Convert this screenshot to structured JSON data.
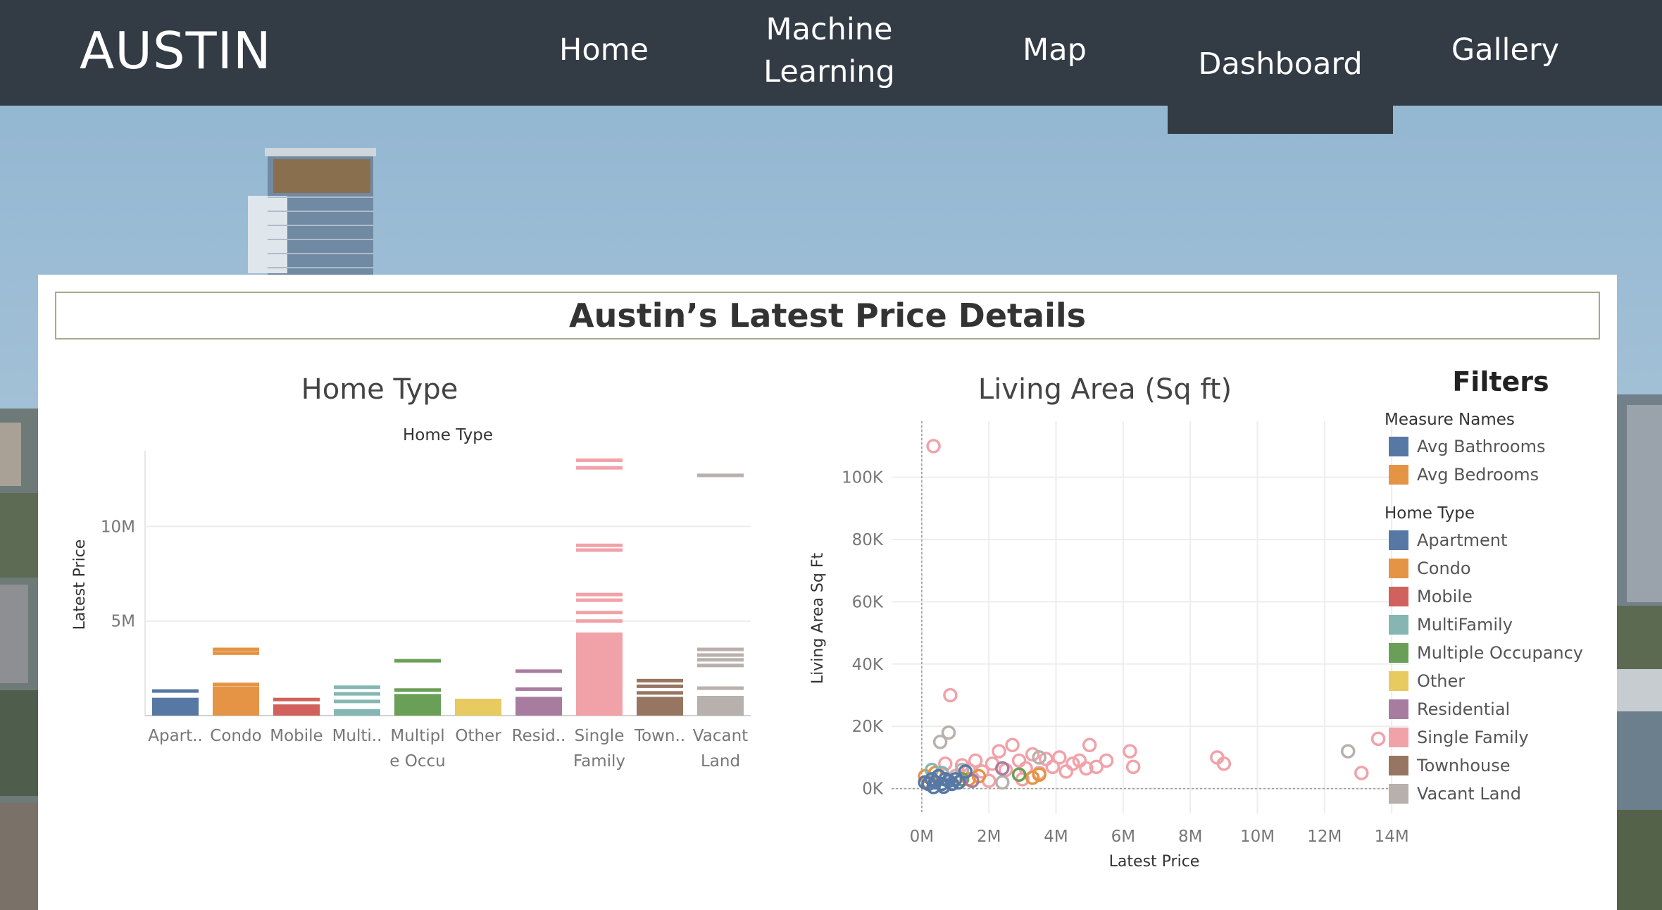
{
  "header": {
    "brand": "AUSTIN",
    "nav": [
      {
        "label": "Home"
      },
      {
        "label": "Machine\nLearning"
      },
      {
        "label": "Map"
      },
      {
        "label": "Dashboard",
        "active": true
      },
      {
        "label": "Gallery"
      }
    ]
  },
  "dashboard": {
    "title": "Austin’s Latest Price Details",
    "home_type_heading": "Home Type",
    "living_area_heading": "Living Area (Sq ft)"
  },
  "filters": {
    "title": "Filters",
    "measure_names_title": "Measure Names",
    "measure_names": [
      {
        "label": "Avg Bathrooms",
        "color": "#5778a4"
      },
      {
        "label": "Avg Bedrooms",
        "color": "#e49444"
      }
    ],
    "home_type_title": "Home Type",
    "home_types": [
      {
        "label": "Apartment",
        "color": "#5778a4"
      },
      {
        "label": "Condo",
        "color": "#e49444"
      },
      {
        "label": "Mobile",
        "color": "#d1615d"
      },
      {
        "label": "MultiFamily",
        "color": "#85b6b2"
      },
      {
        "label": "Multiple Occupancy",
        "color": "#6a9f58"
      },
      {
        "label": "Other",
        "color": "#e7ca60"
      },
      {
        "label": "Residential",
        "color": "#a87c9f"
      },
      {
        "label": "Single Family",
        "color": "#f1a2a9"
      },
      {
        "label": "Townhouse",
        "color": "#967662"
      },
      {
        "label": "Vacant Land",
        "color": "#b8b0ac"
      }
    ]
  },
  "chart_data": [
    {
      "type": "bar",
      "title": "Home Type",
      "xlabel": "",
      "ylabel": "Latest Price",
      "ylim": [
        0,
        14000000
      ],
      "yticks": [
        {
          "value": 5000000,
          "label": "5M"
        },
        {
          "value": 10000000,
          "label": "10M"
        }
      ],
      "grid": true,
      "categories": [
        "Apart..",
        "Condo",
        "Mobile",
        "Multi..",
        "Multipl\ne Occu\npancy",
        "Other",
        "Resid..",
        "Single\nFamily",
        "Town..",
        "Vacant\nLand"
      ],
      "colors": [
        "#5778a4",
        "#e49444",
        "#d1615d",
        "#85b6b2",
        "#6a9f58",
        "#e7ca60",
        "#a87c9f",
        "#f1a2a9",
        "#967662",
        "#b8b0ac"
      ],
      "values": [
        1300000,
        3500000,
        850000,
        1500000,
        2900000,
        800000,
        2350000,
        13500000,
        1850000,
        12700000
      ],
      "stacked_marks": [
        [
          1300000,
          850000
        ],
        [
          3500000,
          3300000,
          1650000,
          1450000
        ],
        [
          850000,
          500000
        ],
        [
          1500000,
          1150000,
          750000,
          250000
        ],
        [
          2900000,
          1350000,
          1050000
        ],
        [
          800000
        ],
        [
          2350000,
          1400000,
          900000
        ],
        [
          13500000,
          13100000,
          9000000,
          8750000,
          6400000,
          6100000,
          5450000,
          5000000,
          4300000
        ],
        [
          1850000,
          1550000,
          1200000,
          900000
        ],
        [
          12700000,
          3500000,
          3200000,
          2950000,
          2650000,
          1450000,
          950000
        ]
      ]
    },
    {
      "type": "scatter",
      "title": "Living Area (Sq ft)",
      "xlabel": "Latest Price",
      "ylabel": "Living Area Sq Ft",
      "xlim": [
        -900000,
        14500000
      ],
      "ylim": [
        -8000,
        118000
      ],
      "xticks": [
        {
          "value": 0,
          "label": "0M"
        },
        {
          "value": 2000000,
          "label": "2M"
        },
        {
          "value": 4000000,
          "label": "4M"
        },
        {
          "value": 6000000,
          "label": "6M"
        },
        {
          "value": 8000000,
          "label": "8M"
        },
        {
          "value": 10000000,
          "label": "10M"
        },
        {
          "value": 12000000,
          "label": "12M"
        },
        {
          "value": 14000000,
          "label": "14M"
        }
      ],
      "yticks": [
        {
          "value": 0,
          "label": "0K"
        },
        {
          "value": 20000,
          "label": "20K"
        },
        {
          "value": 40000,
          "label": "40K"
        },
        {
          "value": 60000,
          "label": "60K"
        },
        {
          "value": 80000,
          "label": "80K"
        },
        {
          "value": 100000,
          "label": "100K"
        }
      ],
      "grid": true,
      "series": [
        {
          "name": "Single Family",
          "color": "#f1a2a9",
          "points": [
            [
              350000,
              110000
            ],
            [
              850000,
              30000
            ],
            [
              1200000,
              7500
            ],
            [
              1600000,
              9000
            ],
            [
              1800000,
              5500
            ],
            [
              2100000,
              8000
            ],
            [
              2300000,
              12000
            ],
            [
              2500000,
              6000
            ],
            [
              2700000,
              14000
            ],
            [
              2900000,
              9000
            ],
            [
              3100000,
              6500
            ],
            [
              3300000,
              11000
            ],
            [
              3500000,
              5000
            ],
            [
              3700000,
              9500
            ],
            [
              3900000,
              7000
            ],
            [
              4100000,
              10000
            ],
            [
              4300000,
              5500
            ],
            [
              4500000,
              8000
            ],
            [
              4700000,
              9000
            ],
            [
              4900000,
              6500
            ],
            [
              5000000,
              14000
            ],
            [
              5200000,
              7000
            ],
            [
              5500000,
              9000
            ],
            [
              6200000,
              12000
            ],
            [
              6300000,
              7000
            ],
            [
              8800000,
              10000
            ],
            [
              9000000,
              8000
            ],
            [
              13600000,
              16000
            ],
            [
              13100000,
              5000
            ],
            [
              1000000,
              4000
            ],
            [
              1400000,
              6000
            ],
            [
              3000000,
              3000
            ],
            [
              2000000,
              2500
            ],
            [
              500000,
              4000
            ],
            [
              700000,
              8000
            ]
          ]
        },
        {
          "name": "Vacant Land",
          "color": "#b8b0ac",
          "points": [
            [
              550000,
              15000
            ],
            [
              800000,
              18000
            ],
            [
              12700000,
              12000
            ],
            [
              1200000,
              6000
            ],
            [
              3500000,
              10000
            ],
            [
              2400000,
              2000
            ]
          ]
        },
        {
          "name": "Condo",
          "color": "#e49444",
          "points": [
            [
              100000,
              4000
            ],
            [
              400000,
              5000
            ],
            [
              700000,
              3000
            ],
            [
              1400000,
              3000
            ],
            [
              1700000,
              4000
            ],
            [
              3300000,
              3500
            ],
            [
              3500000,
              4500
            ],
            [
              200000,
              2000
            ]
          ]
        },
        {
          "name": "Multiple Occupancy",
          "color": "#6a9f58",
          "points": [
            [
              1200000,
              3000
            ],
            [
              2900000,
              4500
            ]
          ]
        },
        {
          "name": "Residential",
          "color": "#a87c9f",
          "points": [
            [
              2400000,
              6500
            ],
            [
              1500000,
              2500
            ]
          ]
        },
        {
          "name": "MultiFamily",
          "color": "#85b6b2",
          "points": [
            [
              600000,
              5000
            ],
            [
              300000,
              6000
            ]
          ]
        },
        {
          "name": "Apartment",
          "color": "#5778a4",
          "points": [
            [
              100000,
              2000
            ],
            [
              200000,
              1500
            ],
            [
              300000,
              3000
            ],
            [
              400000,
              2000
            ],
            [
              500000,
              4000
            ],
            [
              600000,
              1500
            ],
            [
              700000,
              3000
            ],
            [
              800000,
              2500
            ],
            [
              900000,
              1500
            ],
            [
              1000000,
              3000
            ],
            [
              1300000,
              5500
            ],
            [
              1100000,
              2000
            ],
            [
              350000,
              500
            ],
            [
              650000,
              600
            ]
          ]
        }
      ]
    }
  ]
}
